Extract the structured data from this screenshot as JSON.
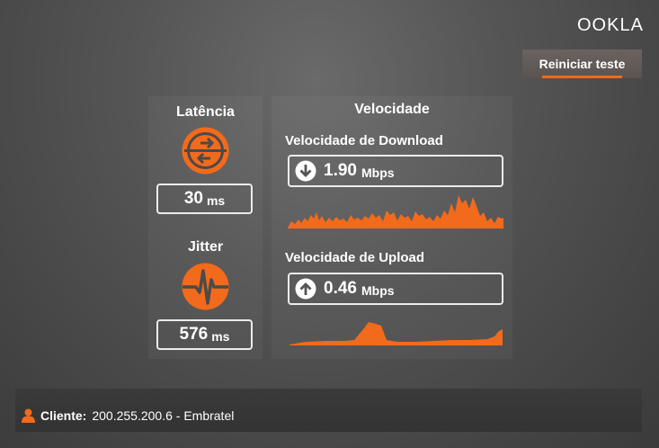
{
  "brand": {
    "logo_text": "OOKLA"
  },
  "header": {
    "restart_label": "Reiniciar teste"
  },
  "latency": {
    "title": "Latência",
    "value": "30",
    "unit": "ms"
  },
  "jitter": {
    "title": "Jitter",
    "value": "576",
    "unit": "ms"
  },
  "speed": {
    "title": "Velocidade",
    "download": {
      "title": "Velocidade de Download",
      "value": "1.90",
      "unit": "Mbps"
    },
    "upload": {
      "title": "Velocidade de Upload",
      "value": "0.46",
      "unit": "Mbps"
    }
  },
  "client": {
    "label": "Cliente:",
    "value": "200.255.200.6 - Embratel"
  },
  "colors": {
    "accent": "#f26a1b",
    "text": "#ffffff"
  },
  "icons": [
    "user-icon",
    "arrows-swap-icon",
    "pulse-icon",
    "arrow-down-icon",
    "arrow-up-icon"
  ]
}
